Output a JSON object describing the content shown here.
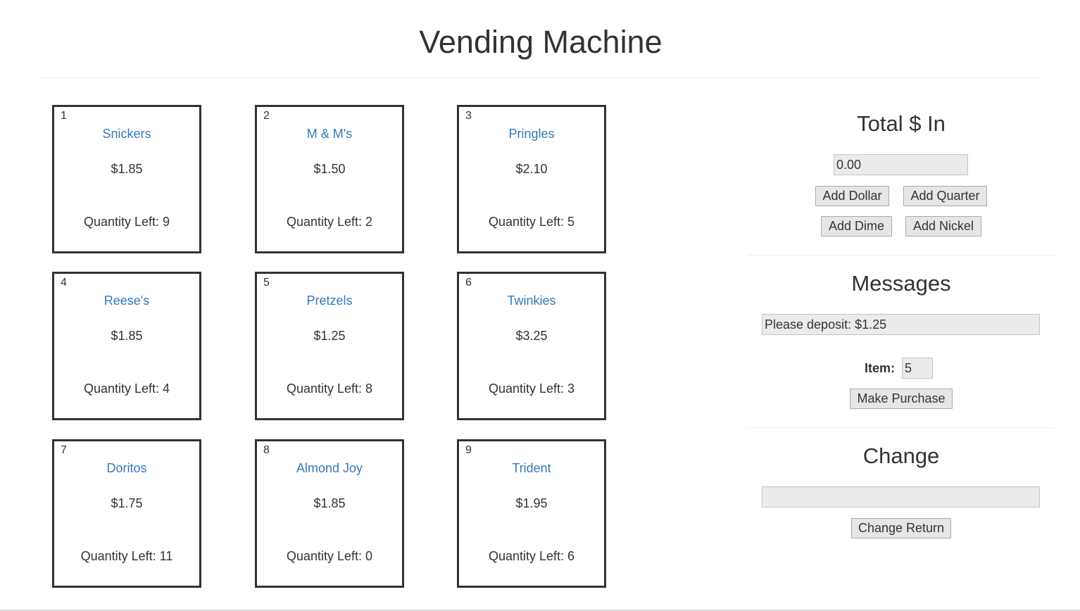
{
  "header": {
    "title": "Vending Machine"
  },
  "items": [
    {
      "number": "1",
      "name": "Snickers",
      "price": "$1.85",
      "quantity": "Quantity Left: 9"
    },
    {
      "number": "2",
      "name": "M & M's",
      "price": "$1.50",
      "quantity": "Quantity Left: 2"
    },
    {
      "number": "3",
      "name": "Pringles",
      "price": "$2.10",
      "quantity": "Quantity Left: 5"
    },
    {
      "number": "4",
      "name": "Reese's",
      "price": "$1.85",
      "quantity": "Quantity Left: 4"
    },
    {
      "number": "5",
      "name": "Pretzels",
      "price": "$1.25",
      "quantity": "Quantity Left: 8"
    },
    {
      "number": "6",
      "name": "Twinkies",
      "price": "$3.25",
      "quantity": "Quantity Left: 3"
    },
    {
      "number": "7",
      "name": "Doritos",
      "price": "$1.75",
      "quantity": "Quantity Left: 11"
    },
    {
      "number": "8",
      "name": "Almond Joy",
      "price": "$1.85",
      "quantity": "Quantity Left: 0"
    },
    {
      "number": "9",
      "name": "Trident",
      "price": "$1.95",
      "quantity": "Quantity Left: 6"
    }
  ],
  "money": {
    "heading": "Total $ In",
    "total_value": "0.00",
    "add_dollar": "Add Dollar",
    "add_quarter": "Add Quarter",
    "add_dime": "Add Dime",
    "add_nickel": "Add Nickel"
  },
  "messages": {
    "heading": "Messages",
    "message_value": "Please deposit: $1.25",
    "item_label": "Item:",
    "item_value": "5",
    "purchase_button": "Make Purchase"
  },
  "change": {
    "heading": "Change",
    "change_value": "",
    "return_button": "Change Return"
  },
  "colors": {
    "link": "#337ab7",
    "text": "#333333",
    "field_bg": "#ebebeb",
    "button_bg": "#e6e6e6"
  }
}
